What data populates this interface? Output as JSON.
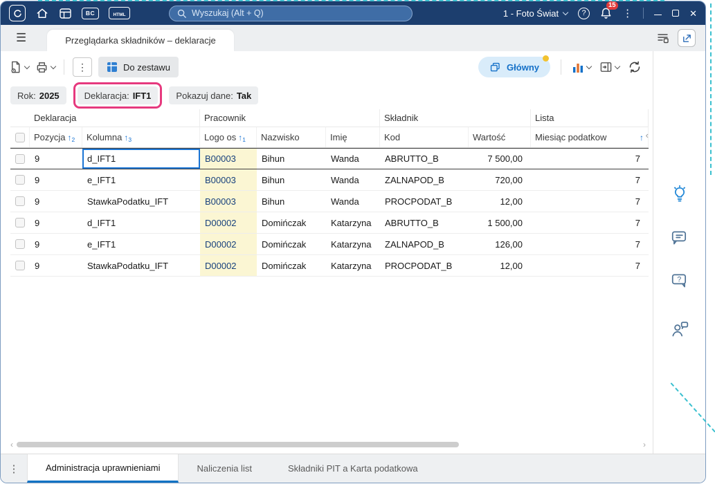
{
  "titlebar": {
    "search_placeholder": "Wyszukaj (Alt + Q)",
    "company_selector": "1 - Foto Świat",
    "notification_count": "15",
    "bc_icon_label": "BC",
    "html_icon_label": "HTML",
    "help_glyph": "?"
  },
  "icons": {
    "hamburger": "☰",
    "kebab": "⋮",
    "close": "✕",
    "sort_asc": "↑",
    "chevron_left_small": "‹",
    "chevron_right_small": "›",
    "collapse_columns": "‹"
  },
  "tabbar": {
    "active_tab": "Przeglądarka składników – deklaracje"
  },
  "toolbar": {
    "add_to_set_label": "Do zestawu",
    "main_button_label": "Główny"
  },
  "filters": {
    "rok": {
      "label": "Rok:",
      "value": "2025",
      "highlighted": false
    },
    "deklaracja": {
      "label": "Deklaracja:",
      "value": "IFT1",
      "highlighted": true
    },
    "pokazuj_dane": {
      "label": "Pokazuj dane:",
      "value": "Tak",
      "highlighted": false
    }
  },
  "table": {
    "group_headers": [
      "Deklaracja",
      "Pracownik",
      "Składnik",
      "Lista"
    ],
    "columns": [
      {
        "label": "Pozycja",
        "sort": "2"
      },
      {
        "label": "Kolumna",
        "sort": "3"
      },
      {
        "label": "Logo os",
        "sort": "1"
      },
      {
        "label": "Nazwisko"
      },
      {
        "label": "Imię"
      },
      {
        "label": "Kod"
      },
      {
        "label": "Wartość"
      },
      {
        "label": "Miesiąc podatkow",
        "sort": ""
      }
    ],
    "selected_row": 0,
    "rows": [
      [
        "9",
        "d_IFT1",
        "B00003",
        "Bihun",
        "Wanda",
        "ABRUTTO_B",
        "7 500,00",
        "7"
      ],
      [
        "9",
        "e_IFT1",
        "B00003",
        "Bihun",
        "Wanda",
        "ZALNAPOD_B",
        "720,00",
        "7"
      ],
      [
        "9",
        "StawkaPodatku_IFT",
        "B00003",
        "Bihun",
        "Wanda",
        "PROCPODAT_B",
        "12,00",
        "7"
      ],
      [
        "9",
        "d_IFT1",
        "D00002",
        "Domińczak",
        "Katarzyna",
        "ABRUTTO_B",
        "1 500,00",
        "7"
      ],
      [
        "9",
        "e_IFT1",
        "D00002",
        "Domińczak",
        "Katarzyna",
        "ZALNAPOD_B",
        "126,00",
        "7"
      ],
      [
        "9",
        "StawkaPodatku_IFT",
        "D00002",
        "Domińczak",
        "Katarzyna",
        "PROCPODAT_B",
        "12,00",
        "7"
      ]
    ]
  },
  "bottombar": {
    "tabs": [
      {
        "label": "Administracja uprawnieniami",
        "active": true
      },
      {
        "label": "Naliczenia list",
        "active": false
      },
      {
        "label": "Składniki PIT a Karta podatkowa",
        "active": false
      }
    ]
  },
  "colors": {
    "titlebar_bg": "#1c3e6e",
    "accent_blue": "#1470c8",
    "badge_red": "#e23b3b",
    "annotation_pink": "#e6397e",
    "annotation_teal": "#3ac0cf",
    "logo_cell_bg": "#fbf6d3"
  }
}
